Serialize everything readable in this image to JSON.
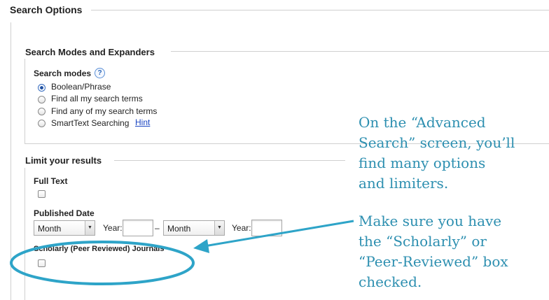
{
  "search_options": {
    "title": "Search Options"
  },
  "modes_section": {
    "title": "Search Modes and Expanders",
    "modes_label": "Search modes",
    "help_glyph": "?",
    "options": [
      {
        "label": "Boolean/Phrase",
        "selected": true
      },
      {
        "label": "Find all my search terms",
        "selected": false
      },
      {
        "label": "Find any of my search terms",
        "selected": false
      },
      {
        "label": "SmartText Searching",
        "selected": false
      }
    ],
    "hint_link": "Hint"
  },
  "limits_section": {
    "title": "Limit your results",
    "full_text_label": "Full Text",
    "published_date_label": "Published Date",
    "from_month": "Month",
    "year_label": "Year:",
    "date_separator": "–",
    "to_month": "Month",
    "from_year_value": "",
    "to_year_value": "",
    "scholarly_label": "Scholarly (Peer Reviewed) Journals"
  },
  "annotations": {
    "note1": "On the “Advanced\nSearch” screen, you’ll\nfind many options\nand limiters.",
    "note2": "Make sure you have\nthe “Scholarly” or\n“Peer-Reviewed” box\nchecked."
  },
  "colors": {
    "annotation": "#2d8fb0",
    "link": "#1a45c2",
    "frame": "#d0d0d0"
  }
}
